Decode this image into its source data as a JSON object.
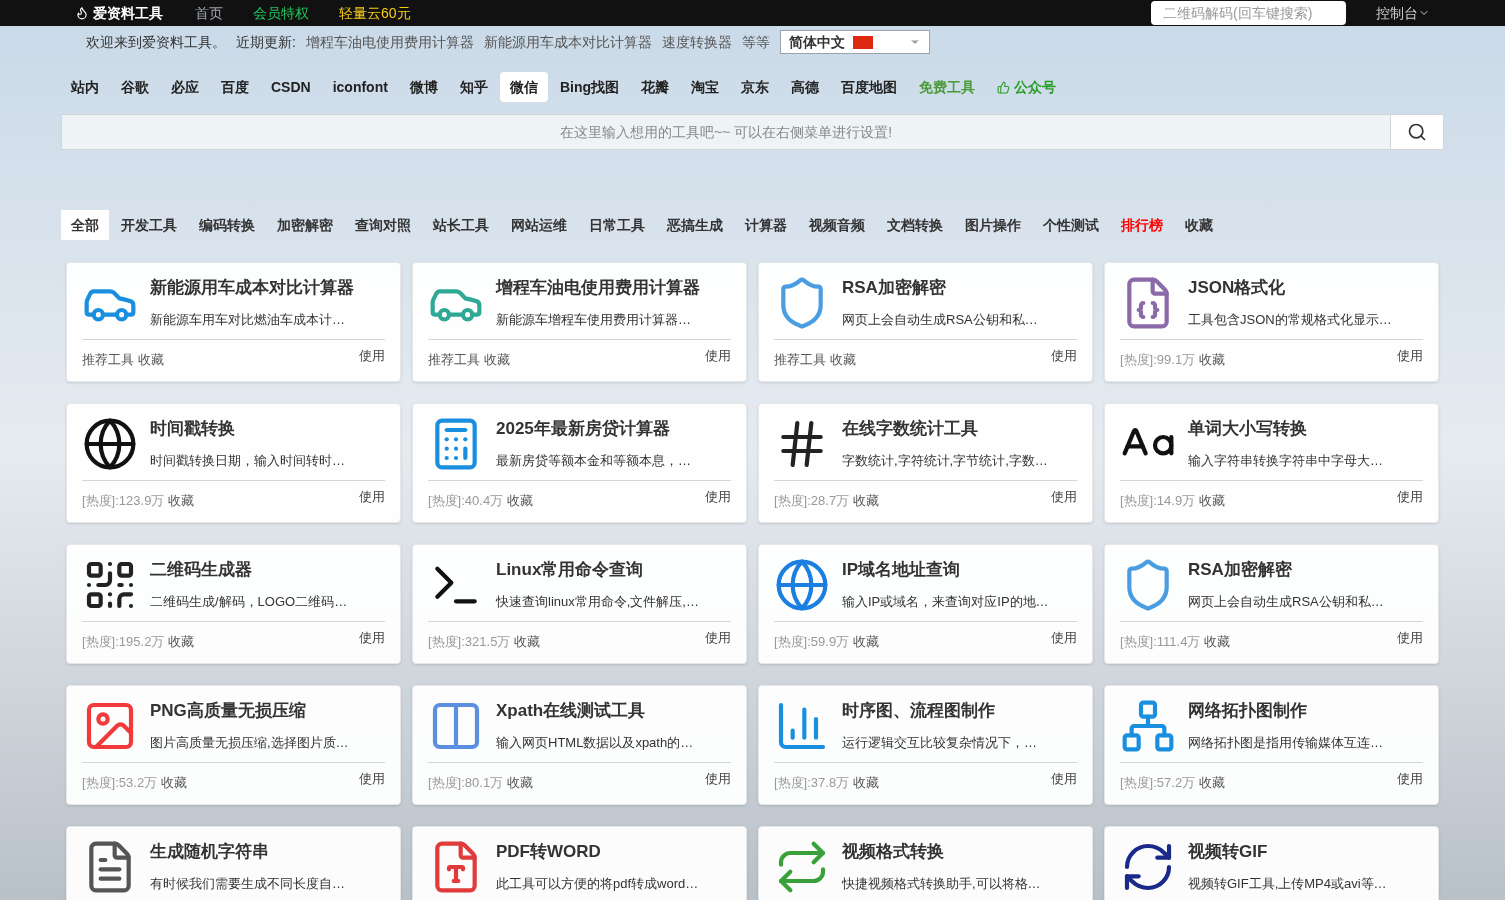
{
  "topbar": {
    "logo": "爱资料工具",
    "nav": [
      {
        "label": "首页",
        "color": "#9ca3af"
      },
      {
        "label": "会员特权",
        "color": "#22c55e"
      },
      {
        "label": "轻量云60元",
        "color": "#facc15"
      }
    ],
    "search": {
      "placeholder": "二维码解码(回车键搜索)"
    },
    "console": "控制台"
  },
  "notice": {
    "welcome": "欢迎来到爱资料工具。",
    "recent_label": "近期更新:",
    "links": [
      "增程车油电使用费用计算器",
      "新能源用车成本对比计算器",
      "速度转换器"
    ],
    "etc": "等等",
    "language": "简体中文"
  },
  "engines": [
    {
      "label": "站内",
      "selected": false,
      "color": "#222222"
    },
    {
      "label": "谷歌",
      "selected": false,
      "color": "#222222"
    },
    {
      "label": "必应",
      "selected": false,
      "color": "#222222"
    },
    {
      "label": "百度",
      "selected": false,
      "color": "#222222"
    },
    {
      "label": "CSDN",
      "selected": false,
      "color": "#222222"
    },
    {
      "label": "iconfont",
      "selected": false,
      "color": "#222222"
    },
    {
      "label": "微博",
      "selected": false,
      "color": "#222222"
    },
    {
      "label": "知乎",
      "selected": false,
      "color": "#222222"
    },
    {
      "label": "微信",
      "selected": true,
      "color": "#222222"
    },
    {
      "label": "Bing找图",
      "selected": false,
      "color": "#222222"
    },
    {
      "label": "花瓣",
      "selected": false,
      "color": "#222222"
    },
    {
      "label": "淘宝",
      "selected": false,
      "color": "#222222"
    },
    {
      "label": "京东",
      "selected": false,
      "color": "#222222"
    },
    {
      "label": "高德",
      "selected": false,
      "color": "#222222"
    },
    {
      "label": "百度地图",
      "selected": false,
      "color": "#222222"
    },
    {
      "label": "免费工具",
      "selected": false,
      "color": "#4a9a3a"
    },
    {
      "label": "公众号",
      "selected": false,
      "color": "#2a9d2a"
    }
  ],
  "main_search": {
    "placeholder": "在这里输入想用的工具吧~~ 可以在右侧菜单进行设置!"
  },
  "categories": [
    {
      "label": "全部",
      "selected": true,
      "color": "#333333"
    },
    {
      "label": "开发工具",
      "selected": false,
      "color": "#333333"
    },
    {
      "label": "编码转换",
      "selected": false,
      "color": "#333333"
    },
    {
      "label": "加密解密",
      "selected": false,
      "color": "#333333"
    },
    {
      "label": "查询对照",
      "selected": false,
      "color": "#333333"
    },
    {
      "label": "站长工具",
      "selected": false,
      "color": "#333333"
    },
    {
      "label": "网站运维",
      "selected": false,
      "color": "#333333"
    },
    {
      "label": "日常工具",
      "selected": false,
      "color": "#333333"
    },
    {
      "label": "恶搞生成",
      "selected": false,
      "color": "#333333"
    },
    {
      "label": "计算器",
      "selected": false,
      "color": "#333333"
    },
    {
      "label": "视频音频",
      "selected": false,
      "color": "#333333"
    },
    {
      "label": "文档转换",
      "selected": false,
      "color": "#333333"
    },
    {
      "label": "图片操作",
      "selected": false,
      "color": "#333333"
    },
    {
      "label": "个性测试",
      "selected": false,
      "color": "#333333"
    },
    {
      "label": "排行榜",
      "selected": false,
      "color": "#ff0000"
    },
    {
      "label": "收藏",
      "selected": false,
      "color": "#333333"
    }
  ],
  "tools": [
    {
      "title": "新能源用车成本对比计算器",
      "desc": "新能源车用车对比燃油车成本计…",
      "footer": {
        "kind": "recommended",
        "text": "推荐工具"
      },
      "favorite": "收藏",
      "use": "使用"
    },
    {
      "title": "增程车油电使用费用计算器",
      "desc": "新能源车增程车使用费用计算器…",
      "footer": {
        "kind": "recommended",
        "text": "推荐工具"
      },
      "favorite": "收藏",
      "use": "使用"
    },
    {
      "title": "RSA加密解密",
      "desc": "网页上会自动生成RSA公钥和私…",
      "footer": {
        "kind": "recommended",
        "text": "推荐工具"
      },
      "favorite": "收藏",
      "use": "使用"
    },
    {
      "title": "JSON格式化",
      "desc": "工具包含JSON的常规格式化显示…",
      "footer": {
        "kind": "heat",
        "text": "[热度]:99.1万"
      },
      "favorite": "收藏",
      "use": "使用"
    },
    {
      "title": "时间戳转换",
      "desc": "时间戳转换日期，输入时间转时…",
      "footer": {
        "kind": "heat",
        "text": "[热度]:123.9万"
      },
      "favorite": "收藏",
      "use": "使用"
    },
    {
      "title": "2025年最新房贷计算器",
      "desc": "最新房贷等额本金和等额本息，…",
      "footer": {
        "kind": "heat",
        "text": "[热度]:40.4万"
      },
      "favorite": "收藏",
      "use": "使用"
    },
    {
      "title": "在线字数统计工具",
      "desc": "字数统计,字符统计,字节统计,字数…",
      "footer": {
        "kind": "heat",
        "text": "[热度]:28.7万"
      },
      "favorite": "收藏",
      "use": "使用"
    },
    {
      "title": "单词大小写转换",
      "desc": "输入字符串转换字符串中字母大…",
      "footer": {
        "kind": "heat",
        "text": "[热度]:14.9万"
      },
      "favorite": "收藏",
      "use": "使用"
    },
    {
      "title": "二维码生成器",
      "desc": "二维码生成/解码，LOGO二维码…",
      "footer": {
        "kind": "heat",
        "text": "[热度]:195.2万"
      },
      "favorite": "收藏",
      "use": "使用"
    },
    {
      "title": "Linux常用命令查询",
      "desc": "快速查询linux常用命令,文件解压,…",
      "footer": {
        "kind": "heat",
        "text": "[热度]:321.5万"
      },
      "favorite": "收藏",
      "use": "使用"
    },
    {
      "title": "IP域名地址查询",
      "desc": "输入IP或域名，来查询对应IP的地…",
      "footer": {
        "kind": "heat",
        "text": "[热度]:59.9万"
      },
      "favorite": "收藏",
      "use": "使用"
    },
    {
      "title": "RSA加密解密",
      "desc": "网页上会自动生成RSA公钥和私…",
      "footer": {
        "kind": "heat",
        "text": "[热度]:111.4万"
      },
      "favorite": "收藏",
      "use": "使用"
    },
    {
      "title": "PNG高质量无损压缩",
      "desc": "图片高质量无损压缩,选择图片质…",
      "footer": {
        "kind": "heat",
        "text": "[热度]:53.2万"
      },
      "favorite": "收藏",
      "use": "使用"
    },
    {
      "title": "Xpath在线测试工具",
      "desc": "输入网页HTML数据以及xpath的…",
      "footer": {
        "kind": "heat",
        "text": "[热度]:80.1万"
      },
      "favorite": "收藏",
      "use": "使用"
    },
    {
      "title": "时序图、流程图制作",
      "desc": "运行逻辑交互比较复杂情况下，…",
      "footer": {
        "kind": "heat",
        "text": "[热度]:37.8万"
      },
      "favorite": "收藏",
      "use": "使用"
    },
    {
      "title": "网络拓扑图制作",
      "desc": "网络拓扑图是指用传输媒体互连…",
      "footer": {
        "kind": "heat",
        "text": "[热度]:57.2万"
      },
      "favorite": "收藏",
      "use": "使用"
    },
    {
      "title": "生成随机字符串",
      "desc": "有时候我们需要生成不同长度自…"
    },
    {
      "title": "PDF转WORD",
      "desc": "此工具可以方便的将pdf转成word…"
    },
    {
      "title": "视频格式转换",
      "desc": "快捷视频格式转换助手,可以将格…"
    },
    {
      "title": "视频转GIF",
      "desc": "视频转GIF工具,上传MP4或avi等…"
    }
  ]
}
